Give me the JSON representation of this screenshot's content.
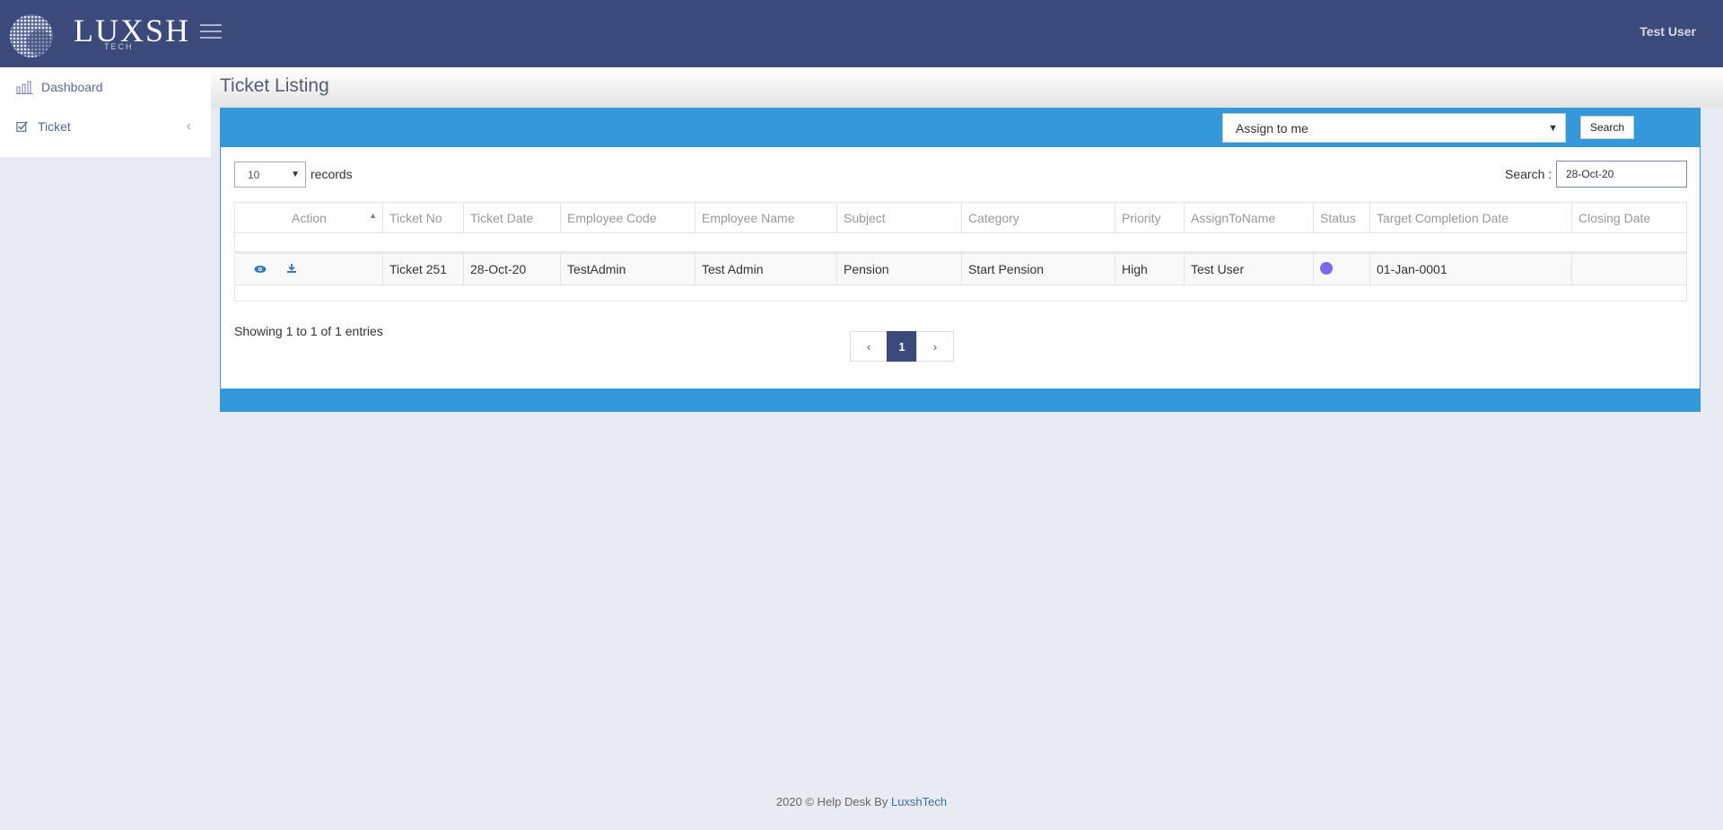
{
  "header": {
    "logo_text": "LUXSH",
    "logo_sub": "TECH",
    "user_name": "Test User"
  },
  "sidebar": {
    "items": [
      {
        "label": "Dashboard",
        "icon": "bar-chart-icon"
      },
      {
        "label": "Ticket",
        "icon": "checkbox-icon"
      }
    ]
  },
  "page": {
    "title": "Ticket Listing"
  },
  "filter": {
    "assign_value": "Assign to me",
    "search_button": "Search"
  },
  "table_controls": {
    "page_length": "10",
    "records_label": "records",
    "search_label": "Search :",
    "search_value": "28-Oct-20"
  },
  "table": {
    "columns": [
      "Action",
      "Ticket No",
      "Ticket Date",
      "Employee Code",
      "Employee Name",
      "Subject",
      "Category",
      "Priority",
      "AssignToName",
      "Status",
      "Target Completion Date",
      "Closing Date"
    ],
    "rows": [
      {
        "ticket_no": "Ticket 251",
        "ticket_date": "28-Oct-20",
        "employee_code": "TestAdmin",
        "employee_name": "Test Admin",
        "subject": "Pension",
        "category": "Start Pension",
        "priority": "High",
        "assign_to": "Test User",
        "status_color": "#7b68ee",
        "target_date": "01-Jan-0001",
        "closing_date": ""
      }
    ]
  },
  "pagination": {
    "info": "Showing 1 to 1 of 1 entries",
    "prev": "‹",
    "current": "1",
    "next": "›"
  },
  "footer": {
    "text": "2020 © Help Desk By ",
    "brand": "LuxshTech"
  },
  "colors": {
    "header_bg": "#3b4a7a",
    "accent": "#3498db",
    "page_bg": "#e8ebf3"
  }
}
